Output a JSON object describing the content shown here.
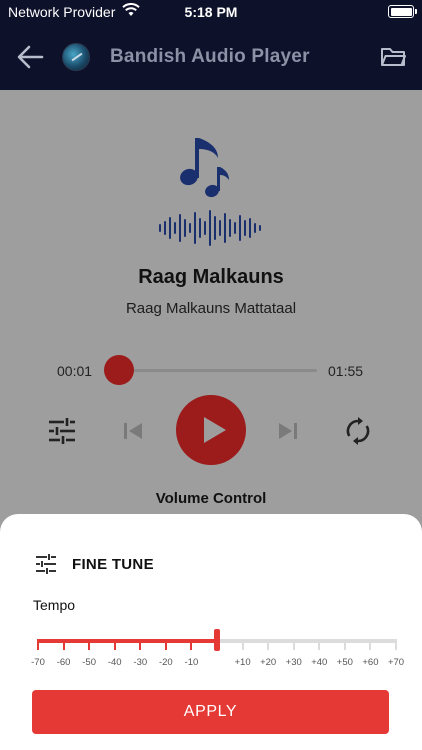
{
  "status_bar": {
    "carrier": "Network Provider",
    "time": "5:18 PM"
  },
  "app_bar": {
    "title": "Bandish Audio Player"
  },
  "player": {
    "song_title": "Raag Malkauns",
    "song_subtitle": "Raag Malkauns Mattataal",
    "current_time": "00:01",
    "total_time": "01:55",
    "volume_label": "Volume Control"
  },
  "sheet": {
    "title": "FINE TUNE",
    "tempo_label": "Tempo",
    "ruler_labels": [
      "-70",
      "-60",
      "-50",
      "-40",
      "-30",
      "-20",
      "-10",
      "",
      "+10",
      "+20",
      "+30",
      "+40",
      "+50",
      "+60",
      "+70"
    ],
    "tempo_value": 0,
    "tempo_min": -70,
    "tempo_max": 70,
    "apply_label": "APPLY"
  },
  "colors": {
    "app_bar": "#0d1129",
    "accent_red": "#e53935",
    "dimmed_red": "#9c1b1b",
    "overlay_grey": "#9e9e9e",
    "icon_blue": "#1a2f6e"
  },
  "icons": [
    "wifi-icon",
    "battery-icon",
    "back-arrow-icon",
    "app-logo-icon",
    "folder-icon",
    "music-note-icon",
    "waveform-icon",
    "adjust-icon",
    "previous-icon",
    "play-icon",
    "next-icon",
    "repeat-icon",
    "tune-icon"
  ]
}
